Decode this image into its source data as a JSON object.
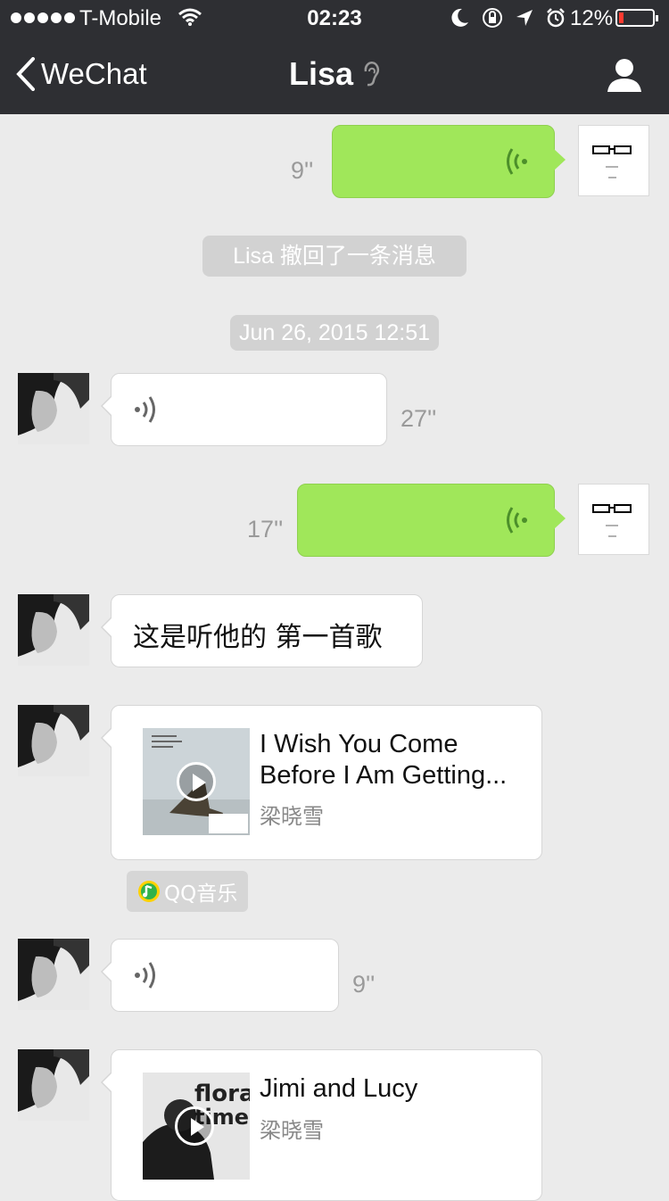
{
  "status_bar": {
    "carrier": "T-Mobile",
    "time": "02:23",
    "battery": "12%"
  },
  "nav": {
    "back_label": "WeChat",
    "title": "Lisa"
  },
  "messages": {
    "m1_duration": "9''",
    "recall_notice": "Lisa 撤回了一条消息",
    "timestamp": "Jun 26, 2015 12:51",
    "m2_duration": "27''",
    "m3_duration": "17''",
    "m4_text": "这是听他的 第一首歌",
    "m5_song_title_line1": "I Wish You Come",
    "m5_song_title_line2": "Before I Am Getting...",
    "m5_artist": "梁晓雪",
    "m5_source": "QQ音乐",
    "m6_duration": "9''",
    "m7_song_title": "Jimi and Lucy",
    "m7_artist": "梁晓雪",
    "m7_cover_text_1": "floral",
    "m7_cover_text_2": "times"
  },
  "colors": {
    "topbar": "#2e2f33",
    "chat_bg": "#ebebeb",
    "outgoing_bubble": "#a0e75a",
    "incoming_bubble": "#ffffff",
    "battery_low": "#ff3b30"
  },
  "icons": [
    "signal-dots-icon",
    "wifi-icon",
    "moon-icon",
    "rotation-lock-icon",
    "location-arrow-icon",
    "alarm-icon",
    "battery-icon",
    "back-chevron-icon",
    "earpiece-icon",
    "profile-icon",
    "voice-wave-icon",
    "play-icon",
    "qq-music-icon"
  ]
}
